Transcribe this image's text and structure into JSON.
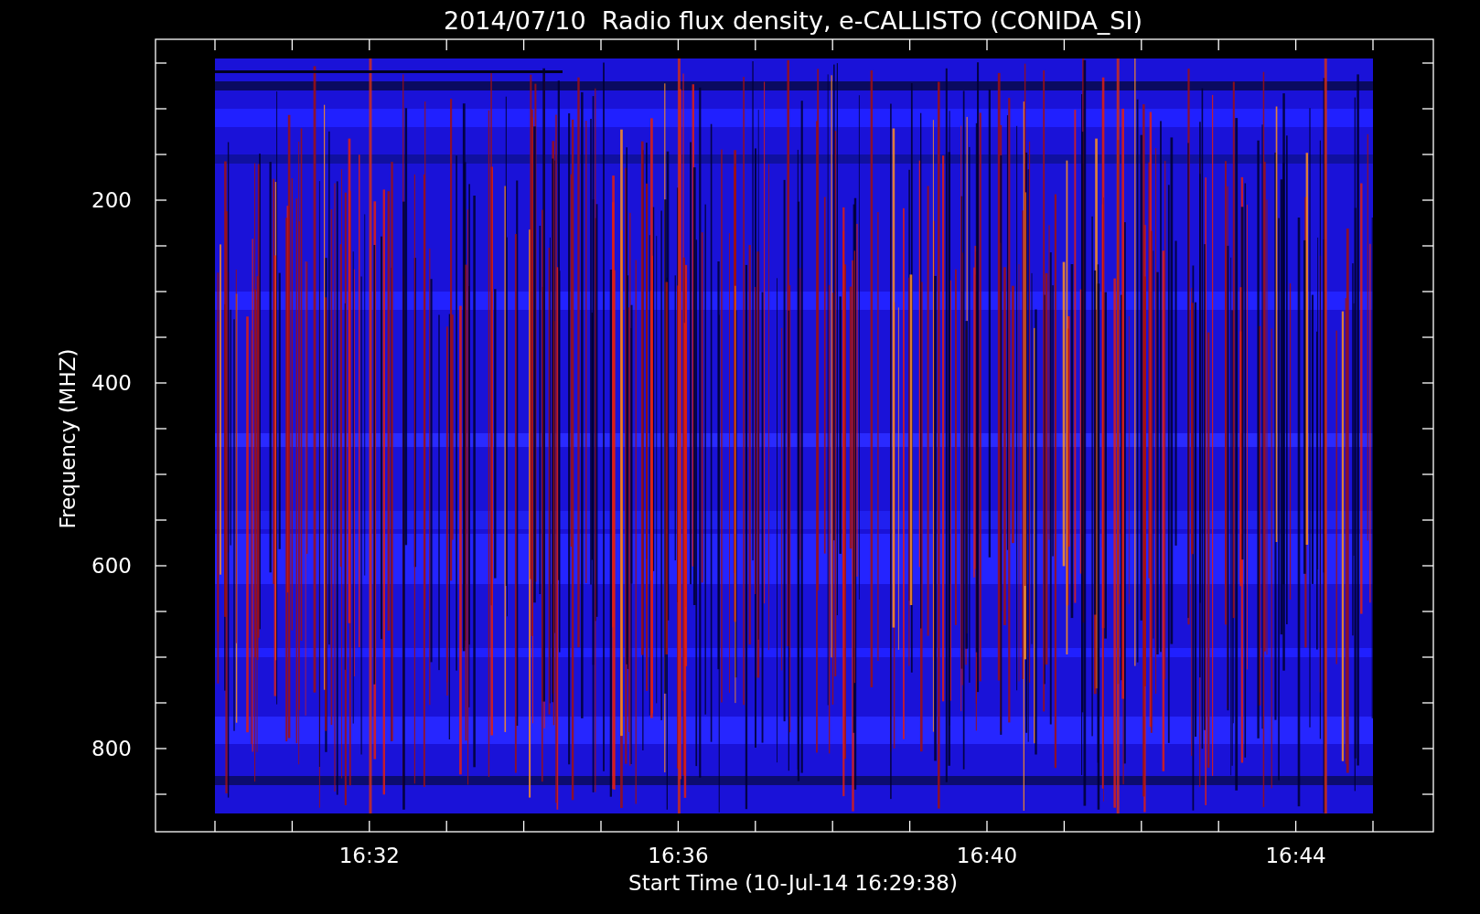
{
  "chart": {
    "title": "2014/07/10  Radio flux density, e-CALLISTO (CONIDA_SI)",
    "xlabel": "Start Time (10-Jul-14 16:29:38)",
    "ylabel": "Frequency (MHZ)",
    "x_tick_labels": [
      "16:32",
      "16:36",
      "16:40",
      "16:44"
    ],
    "y_tick_labels": [
      "200",
      "400",
      "600",
      "800"
    ]
  }
}
